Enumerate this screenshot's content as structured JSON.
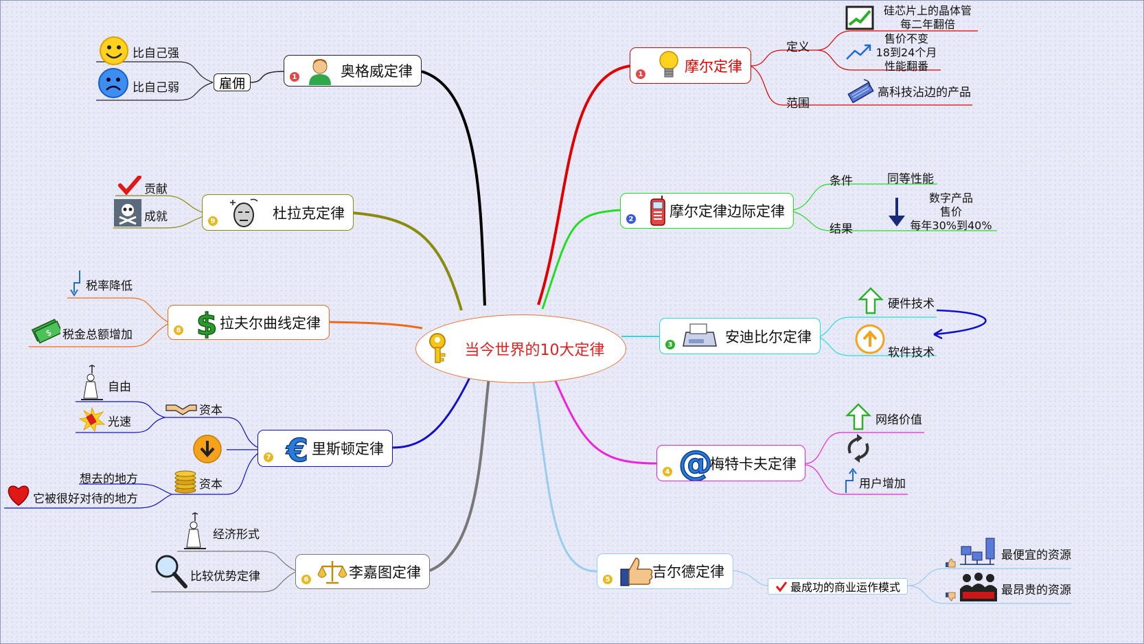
{
  "center": {
    "title": "当今世界的10大定律"
  },
  "laws": {
    "aogewei": {
      "num": "1",
      "label": "奥格威定律",
      "sub": {
        "hire": "雇佣",
        "stronger": "比自己强",
        "weaker": "比自己弱"
      }
    },
    "moore": {
      "num": "1",
      "label": "摩尔定律",
      "definition": "定义",
      "scope": "范围",
      "chip_line1": "硅芯片上的晶体管",
      "chip_line2": "每二年翻倍",
      "price_line1": "售价不变",
      "price_line2": "18到24个月",
      "price_line3": "性能翻番",
      "hitech": "高科技沾边的产品"
    },
    "moore_marginal": {
      "num": "2",
      "label": "摩尔定律边际定律",
      "condition": "条件",
      "same_perf": "同等性能",
      "result": "结果",
      "res_line1": "数字产品",
      "res_line2": "售价",
      "res_line3": "每年30%到40%"
    },
    "andy_bill": {
      "num": "3",
      "label": "安迪比尔定律",
      "hardware": "硬件技术",
      "software": "软件技术"
    },
    "metcalfe": {
      "num": "4",
      "label": "梅特卡夫定律",
      "network": "网络价值",
      "users": "用户增加"
    },
    "gilder": {
      "num": "5",
      "label": "吉尔德定律",
      "model": "最成功的商业运作模式",
      "cheapest": "最便宜的资源",
      "expensive": "最昂贵的资源"
    },
    "ricardo": {
      "num": "6",
      "label": "李嘉图定律",
      "economy": "经济形式",
      "comparative": "比较优势定律"
    },
    "rifkin": {
      "num": "7",
      "label": "里斯顿定律",
      "capital1": "资本",
      "freedom": "自由",
      "lightspeed": "光速",
      "capital2": "资本",
      "want_go": "想去的地方",
      "treated": "它被很好对待的地方"
    },
    "laffer": {
      "num": "8",
      "label": "拉夫尔曲线定律",
      "tax_rate": "税率降低",
      "tax_total": "税金总额增加"
    },
    "drucker": {
      "num": "9",
      "label": "杜拉克定律",
      "contribution": "贡献",
      "achievement": "成就"
    }
  },
  "colors": {
    "moore": "#e00000",
    "marginal": "#22dd22",
    "andy": "#22dddd",
    "metcalfe": "#ee22dd",
    "gilder": "#99ccee",
    "ricardo": "#777777",
    "rifkin": "#1010cc",
    "laffer": "#ee6a1a",
    "drucker": "#8a8a10",
    "aogewei": "#000000"
  }
}
